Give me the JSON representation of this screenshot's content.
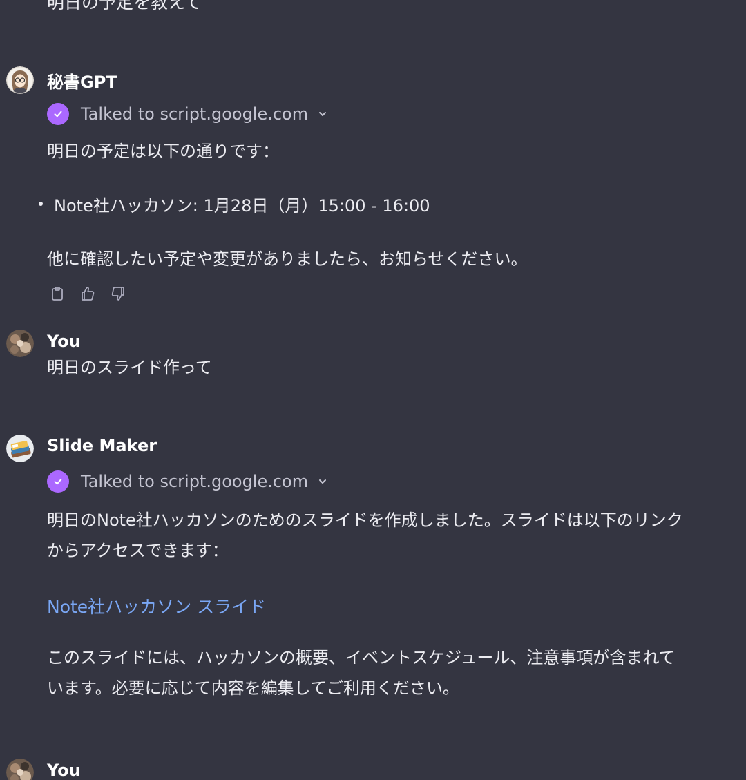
{
  "top_partial_message": "明日の予定を教えて",
  "messages": [
    {
      "author": "秘書GPT",
      "tool_status": "Talked to script.google.com",
      "intro": "明日の予定は以下の通りです：",
      "bullet": "Note社ハッカソン: 1月28日（月）15:00 - 16:00",
      "outro": "他に確認したい予定や変更がありましたら、お知らせください。"
    },
    {
      "author": "You",
      "text": "明日のスライド作って"
    },
    {
      "author": "Slide Maker",
      "tool_status": "Talked to script.google.com",
      "line1": "明日のNote社ハッカソンのためのスライドを作成しました。スライドは以下のリンク",
      "line2": "からアクセスできます：",
      "link_text": "Note社ハッカソン スライド",
      "line3": "このスライドには、ハッカソンの概要、イベントスケジュール、注意事項が含まれて",
      "line4": "います。必要に応じて内容を編集してご利用ください。"
    },
    {
      "author": "You"
    }
  ],
  "icons": {
    "copy": "clipboard-icon",
    "like": "thumbs-up-icon",
    "dislike": "thumbs-down-icon",
    "tool_check": "check-icon",
    "expand": "chevron-down-icon"
  },
  "colors": {
    "background": "#343541",
    "text": "#ececf1",
    "tool_check": "#ab68ff",
    "link": "#7aa7f5"
  }
}
